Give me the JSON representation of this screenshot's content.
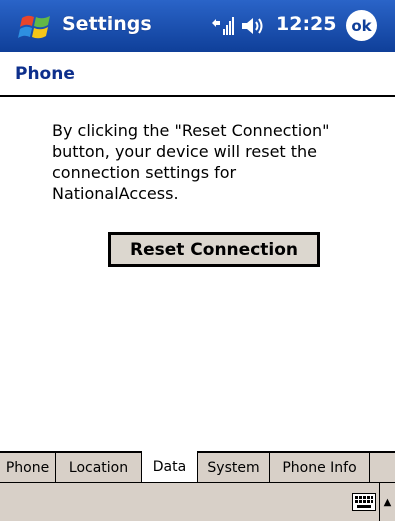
{
  "titlebar": {
    "title": "Settings",
    "time": "12:25",
    "ok_label": "ok",
    "start_icon": "windows-flag-icon",
    "signal_icon": "signal-icon",
    "speaker_icon": "speaker-icon",
    "bg_color": "#1a4fb0"
  },
  "page": {
    "title": "Phone"
  },
  "content": {
    "lines": [
      "By clicking the \"Reset Connection\"",
      "button, your device will reset the",
      "connection settings for",
      "NationalAccess."
    ],
    "reset_button_label": "Reset Connection"
  },
  "tabs": [
    {
      "label": "Phone",
      "active": false
    },
    {
      "label": "Location",
      "active": false
    },
    {
      "label": "Data",
      "active": true
    },
    {
      "label": "System",
      "active": false
    },
    {
      "label": "Phone Info",
      "active": false
    }
  ],
  "cmdbar": {
    "keyboard_icon": "keyboard-icon",
    "arrow_icon": "up-arrow-icon"
  }
}
